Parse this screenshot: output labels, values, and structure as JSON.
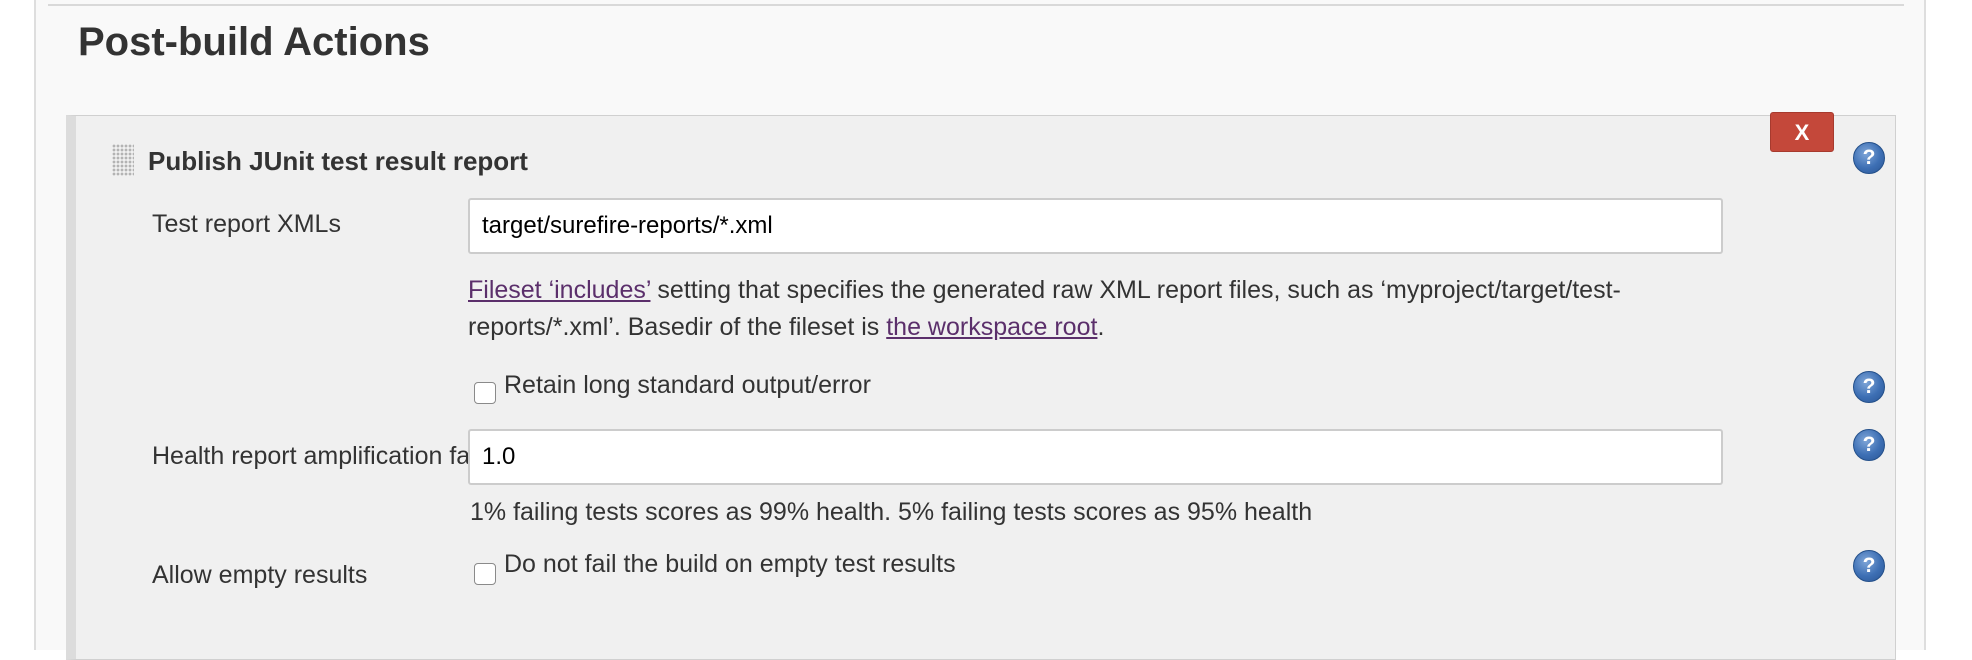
{
  "section": {
    "title": "Post-build Actions"
  },
  "panel": {
    "title": "Publish JUnit test result report",
    "delete_label": "X",
    "help_glyph": "?",
    "test_report": {
      "label": "Test report XMLs",
      "value": "target/surefire-reports/*.xml",
      "desc_link1": "Fileset ‘includes’",
      "desc_text1": " setting that specifies the generated raw XML report files, such as ‘myproject/target/test-reports/*.xml’. Basedir of the fileset is ",
      "desc_link2": "the workspace root",
      "desc_text2": "."
    },
    "retain": {
      "label": "Retain long standard output/error",
      "checked": false
    },
    "health": {
      "label": "Health report amplification factor",
      "value": "1.0",
      "desc": "1% failing tests scores as 99% health. 5% failing tests scores as 95% health"
    },
    "allow_empty": {
      "label": "Allow empty results",
      "checkbox_label": "Do not fail the build on empty test results",
      "checked": false
    }
  },
  "colors": {
    "delete_button": "#c4483a",
    "help_icon": "#3d6fb4",
    "link": "#5b2f6b"
  }
}
